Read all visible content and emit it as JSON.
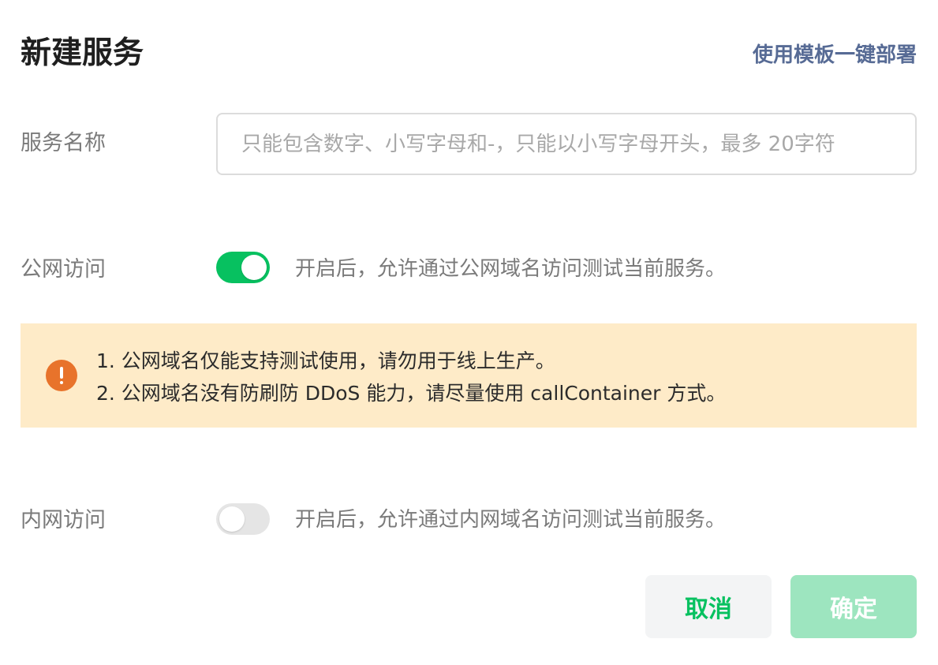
{
  "dialog": {
    "title": "新建服务",
    "template_link": "使用模板一键部署"
  },
  "service_name": {
    "label": "服务名称",
    "value": "",
    "placeholder": "只能包含数字、小写字母和-，只能以小写字母开头，最多 20字符"
  },
  "public_access": {
    "label": "公网访问",
    "enabled": true,
    "description": "开启后，允许通过公网域名访问测试当前服务。"
  },
  "warning": {
    "icon": "exclamation-circle-icon",
    "color": "#e8732b",
    "background": "#feebc8",
    "lines": [
      "1. 公网域名仅能支持测试使用，请勿用于线上生产。",
      "2. 公网域名没有防刷防 DDoS 能力，请尽量使用 callContainer 方式。"
    ]
  },
  "private_access": {
    "label": "内网访问",
    "enabled": false,
    "description": "开启后，允许通过内网域名访问测试当前服务。"
  },
  "buttons": {
    "cancel_label": "取消",
    "confirm_label": "确定",
    "confirm_disabled": true
  },
  "colors": {
    "accent": "#07c160",
    "link": "#576b95",
    "confirm_disabled_bg": "#9de5bf",
    "toggle_off": "#e5e5e5"
  }
}
